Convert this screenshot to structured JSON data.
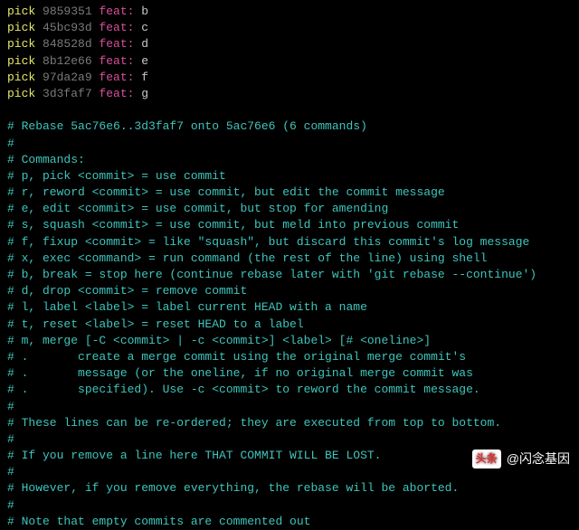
{
  "picks": [
    {
      "cmd": "pick",
      "hash": "9859351",
      "prefix": "feat:",
      "msg": " b"
    },
    {
      "cmd": "pick",
      "hash": "45bc93d",
      "prefix": "feat:",
      "msg": " c"
    },
    {
      "cmd": "pick",
      "hash": "848528d",
      "prefix": "feat:",
      "msg": " d"
    },
    {
      "cmd": "pick",
      "hash": "8b12e66",
      "prefix": "feat:",
      "msg": " e"
    },
    {
      "cmd": "pick",
      "hash": "97da2a9",
      "prefix": "feat:",
      "msg": " f"
    },
    {
      "cmd": "pick",
      "hash": "3d3faf7",
      "prefix": "feat:",
      "msg": " g"
    }
  ],
  "comments": [
    "",
    "# Rebase 5ac76e6..3d3faf7 onto 5ac76e6 (6 commands)",
    "#",
    "# Commands:",
    "# p, pick <commit> = use commit",
    "# r, reword <commit> = use commit, but edit the commit message",
    "# e, edit <commit> = use commit, but stop for amending",
    "# s, squash <commit> = use commit, but meld into previous commit",
    "# f, fixup <commit> = like \"squash\", but discard this commit's log message",
    "# x, exec <command> = run command (the rest of the line) using shell",
    "# b, break = stop here (continue rebase later with 'git rebase --continue')",
    "# d, drop <commit> = remove commit",
    "# l, label <label> = label current HEAD with a name",
    "# t, reset <label> = reset HEAD to a label",
    "# m, merge [-C <commit> | -c <commit>] <label> [# <oneline>]",
    "# .       create a merge commit using the original merge commit's",
    "# .       message (or the oneline, if no original merge commit was",
    "# .       specified). Use -c <commit> to reword the commit message.",
    "#",
    "# These lines can be re-ordered; they are executed from top to bottom.",
    "#",
    "# If you remove a line here THAT COMMIT WILL BE LOST.",
    "#",
    "# However, if you remove everything, the rebase will be aborted.",
    "#",
    "# Note that empty commits are commented out"
  ],
  "watermark": {
    "logo": "头条",
    "handle": "@闪念基因"
  }
}
